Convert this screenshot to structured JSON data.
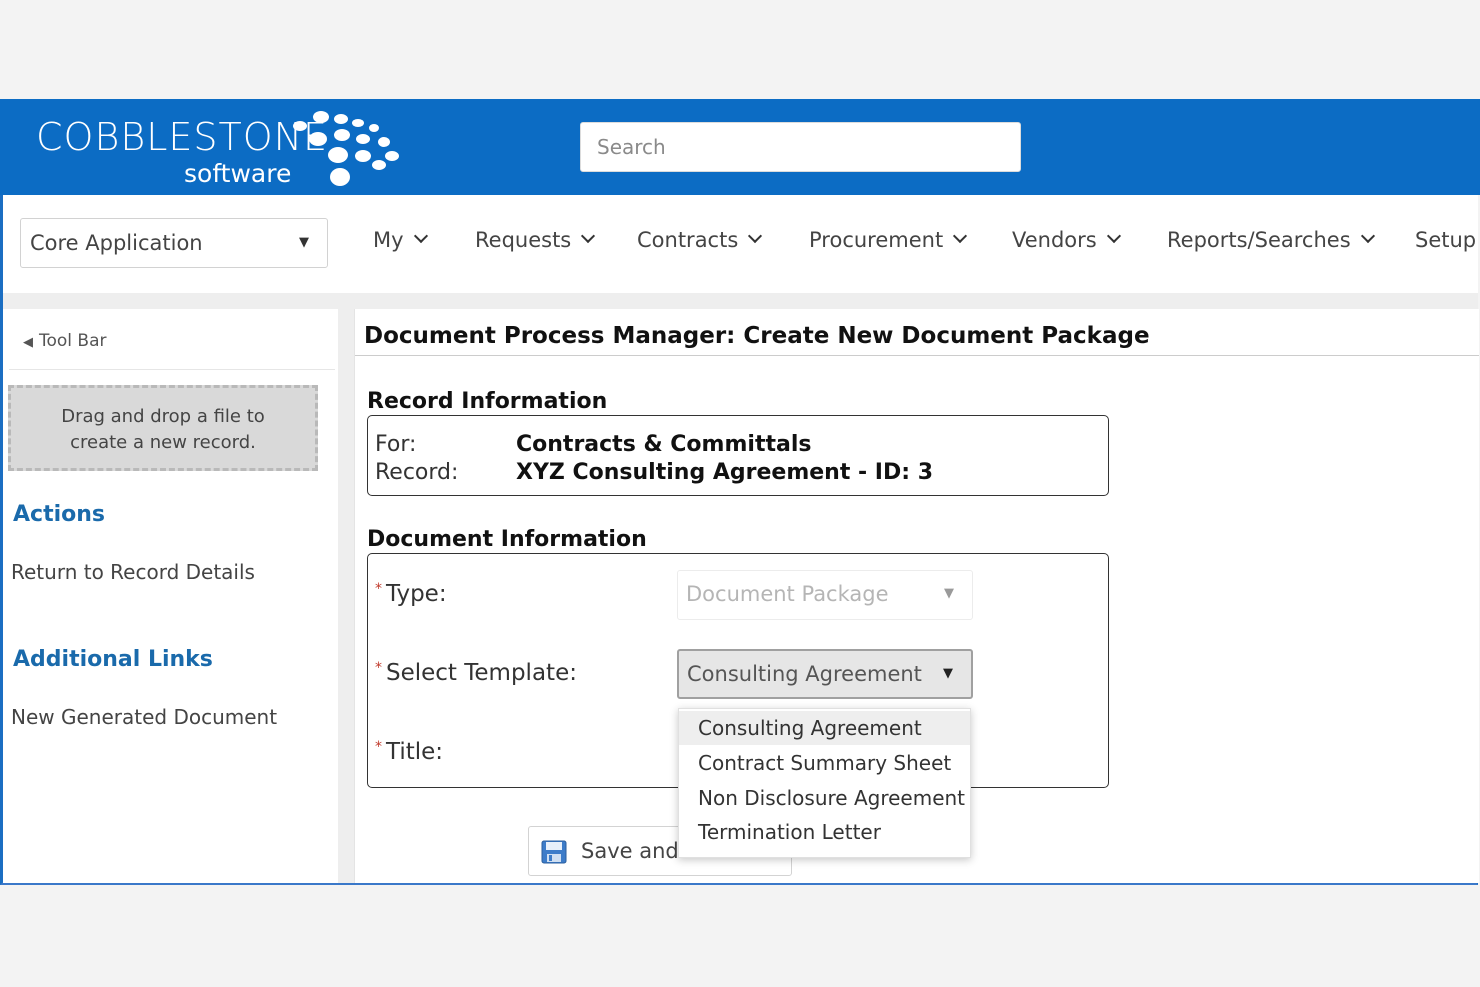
{
  "brand": {
    "name": "COBBLESTONE",
    "sub": "software",
    "header_color": "#0c6cc4",
    "link_color": "#1a6aab"
  },
  "search": {
    "placeholder": "Search"
  },
  "nav": {
    "app_selector": "Core Application",
    "items": [
      "My",
      "Requests",
      "Contracts",
      "Procurement",
      "Vendors",
      "Reports/Searches",
      "Setup"
    ]
  },
  "sidebar": {
    "toolbar_label": "Tool Bar",
    "dropzone_line1": "Drag and drop a file to",
    "dropzone_line2": "create a new record.",
    "actions_heading": "Actions",
    "actions": [
      "Return to Record Details"
    ],
    "links_heading": "Additional Links",
    "links": [
      "New Generated Document"
    ]
  },
  "main": {
    "page_title": "Document Process Manager: Create New Document Package",
    "record_section": "Record Information",
    "record": {
      "for_label": "For:",
      "for_value": "Contracts & Committals",
      "record_label": "Record:",
      "record_value": "XYZ Consulting Agreement - ID: 3"
    },
    "document_section": "Document Information",
    "fields": {
      "type_label": "Type:",
      "type_value": "Document Package",
      "template_label": "Select Template:",
      "template_value": "Consulting Agreement",
      "title_label": "Title:"
    },
    "template_options": [
      "Consulting Agreement",
      "Contract Summary Sheet",
      "Non Disclosure Agreement",
      "Termination Letter"
    ],
    "save_button": "Save and"
  }
}
